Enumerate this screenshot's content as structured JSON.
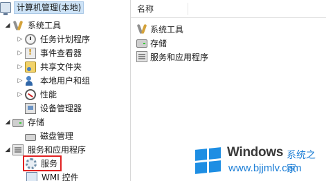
{
  "tree": {
    "root_label": "计算机管理(本地)",
    "items": [
      {
        "label": "系统工具",
        "icon": "tools-icon",
        "expander": "expanded"
      },
      {
        "label": "任务计划程序",
        "icon": "task-scheduler-icon",
        "expander": "collapsed"
      },
      {
        "label": "事件查看器",
        "icon": "event-viewer-icon",
        "expander": "collapsed"
      },
      {
        "label": "共享文件夹",
        "icon": "shared-folder-icon",
        "expander": "collapsed"
      },
      {
        "label": "本地用户和组",
        "icon": "users-icon",
        "expander": "collapsed"
      },
      {
        "label": "性能",
        "icon": "performance-icon",
        "expander": "collapsed"
      },
      {
        "label": "设备管理器",
        "icon": "device-manager-icon",
        "expander": "none"
      },
      {
        "label": "存储",
        "icon": "storage-icon",
        "expander": "expanded"
      },
      {
        "label": "磁盘管理",
        "icon": "disk-icon",
        "expander": "none"
      },
      {
        "label": "服务和应用程序",
        "icon": "services-apps-icon",
        "expander": "expanded"
      },
      {
        "label": "服务",
        "icon": "services-gear-icon",
        "expander": "none",
        "selected": true
      },
      {
        "label": "WMI 控件",
        "icon": "wmi-icon",
        "expander": "none"
      }
    ]
  },
  "list": {
    "header": "名称",
    "rows": [
      {
        "label": "系统工具",
        "icon": "tools-icon"
      },
      {
        "label": "存储",
        "icon": "storage-icon"
      },
      {
        "label": "服务和应用程序",
        "icon": "services-apps-icon"
      }
    ]
  },
  "watermark": {
    "brand": "Windows",
    "brand_cn": "系统之家",
    "url": "www.bjjmlv.com"
  },
  "colors": {
    "selection_highlight": "#e02020",
    "root_highlight": "#cde3f7",
    "watermark_blue": "#1e8ee3"
  }
}
